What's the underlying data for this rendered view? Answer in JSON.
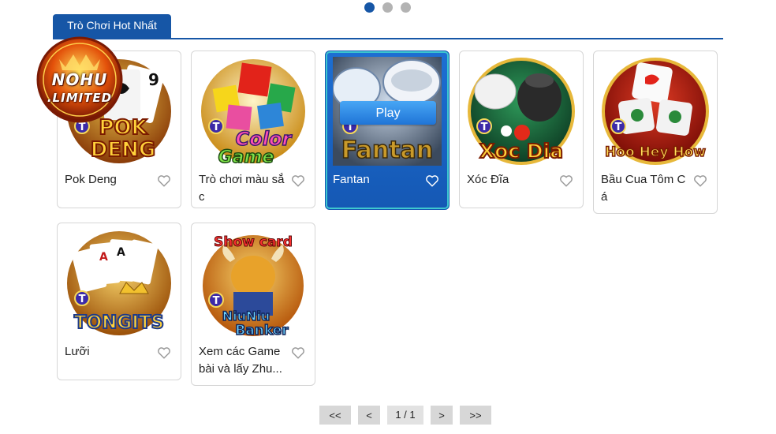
{
  "carousel": {
    "dots": 3,
    "active": 0
  },
  "section": {
    "tab_label": "Trò Chơi Hot Nhất"
  },
  "logo": {
    "line1": "NOHU",
    "line2": ".LIMITED"
  },
  "games": [
    {
      "title": "Pok Deng",
      "art_text": [
        "POK",
        "DENG"
      ]
    },
    {
      "title": "Trò chơi màu sắc",
      "art_text": [
        "Color",
        "Game"
      ]
    },
    {
      "title": "Fantan",
      "art_text": [
        "Fantan"
      ],
      "play_label": "Play"
    },
    {
      "title": "Xóc Đĩa",
      "art_text": [
        "Xoc Dia"
      ]
    },
    {
      "title": "Bầu Cua Tôm Cá",
      "art_text": [
        "Hoo Hey How"
      ]
    },
    {
      "title": "Lưỡi",
      "art_text": [
        "TONGITS"
      ]
    },
    {
      "title": "Xem các Game bài và lấy Zhu...",
      "art_text": [
        "Show card",
        "NiuNiu",
        "Banker"
      ]
    }
  ],
  "badge_letter": "T",
  "pagination": {
    "first": "<<",
    "prev": "<",
    "current": "1 / 1",
    "next": ">",
    "last": ">>"
  },
  "colors": {
    "accent": "#1656a6",
    "active_card": "#1d6fd3",
    "pager_bg": "#d7d7d7"
  }
}
